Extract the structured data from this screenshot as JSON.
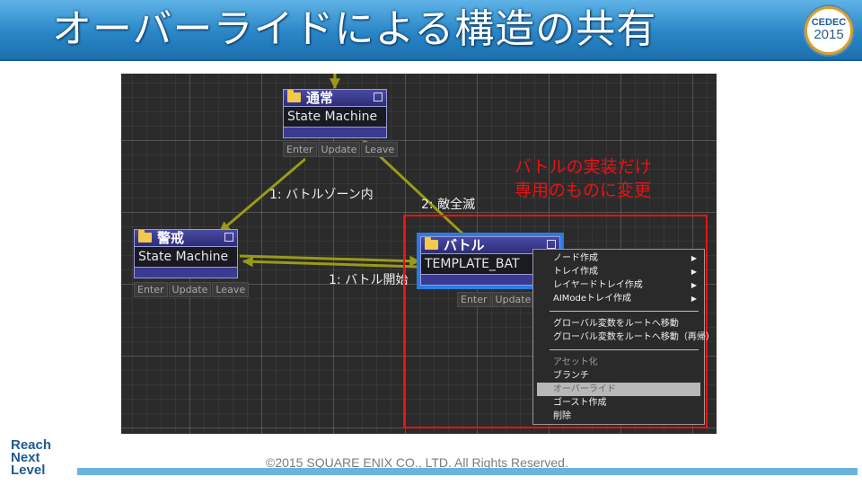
{
  "slide": {
    "title": "オーバーライドによる構造の共有",
    "logo": {
      "name": "CEDEC",
      "year": "2015"
    },
    "copyright": "©2015 SQUARE ENIX CO., LTD. All Rights Reserved.",
    "brand_logo": [
      "Reach",
      "Next",
      "Level"
    ]
  },
  "editor": {
    "nodes": {
      "normal": {
        "title": "通常",
        "field": "State Machine",
        "buttons": [
          "Enter",
          "Update",
          "Leave"
        ]
      },
      "alert": {
        "title": "警戒",
        "field": "State Machine",
        "buttons": [
          "Enter",
          "Update",
          "Leave"
        ]
      },
      "battle": {
        "title": "バトル",
        "field": "TEMPLATE_BAT",
        "buttons": [
          "Enter",
          "Update"
        ]
      }
    },
    "edges": {
      "to_alert": "1: バトルゾーン内",
      "to_normal": "2: 敵全滅",
      "to_battle": "1: バトル開始"
    },
    "annotation": [
      "バトルの実装だけ",
      "専用のものに変更"
    ],
    "context_menu": {
      "group1": [
        {
          "label": "ノード作成",
          "arrow": "▶"
        },
        {
          "label": "トレイ作成",
          "arrow": "▶"
        },
        {
          "label": "レイヤードトレイ作成",
          "arrow": "▶"
        },
        {
          "label": "AIModeトレイ作成",
          "arrow": "▶"
        }
      ],
      "group2": [
        "グローバル変数をルートへ移動",
        "グローバル変数をルートへ移動（再帰）"
      ],
      "group3": {
        "disabled": "アセット化",
        "branch": "ブランチ",
        "override": "オーバーライド",
        "ghost": "ゴースト作成",
        "delete": "削除"
      }
    }
  },
  "colors": {
    "header_blue": "#2a86c7",
    "annotation_red": "#ee1111",
    "node_header": "#3a3a92",
    "wire": "#9a9a18",
    "selection": "#2a7be4"
  }
}
